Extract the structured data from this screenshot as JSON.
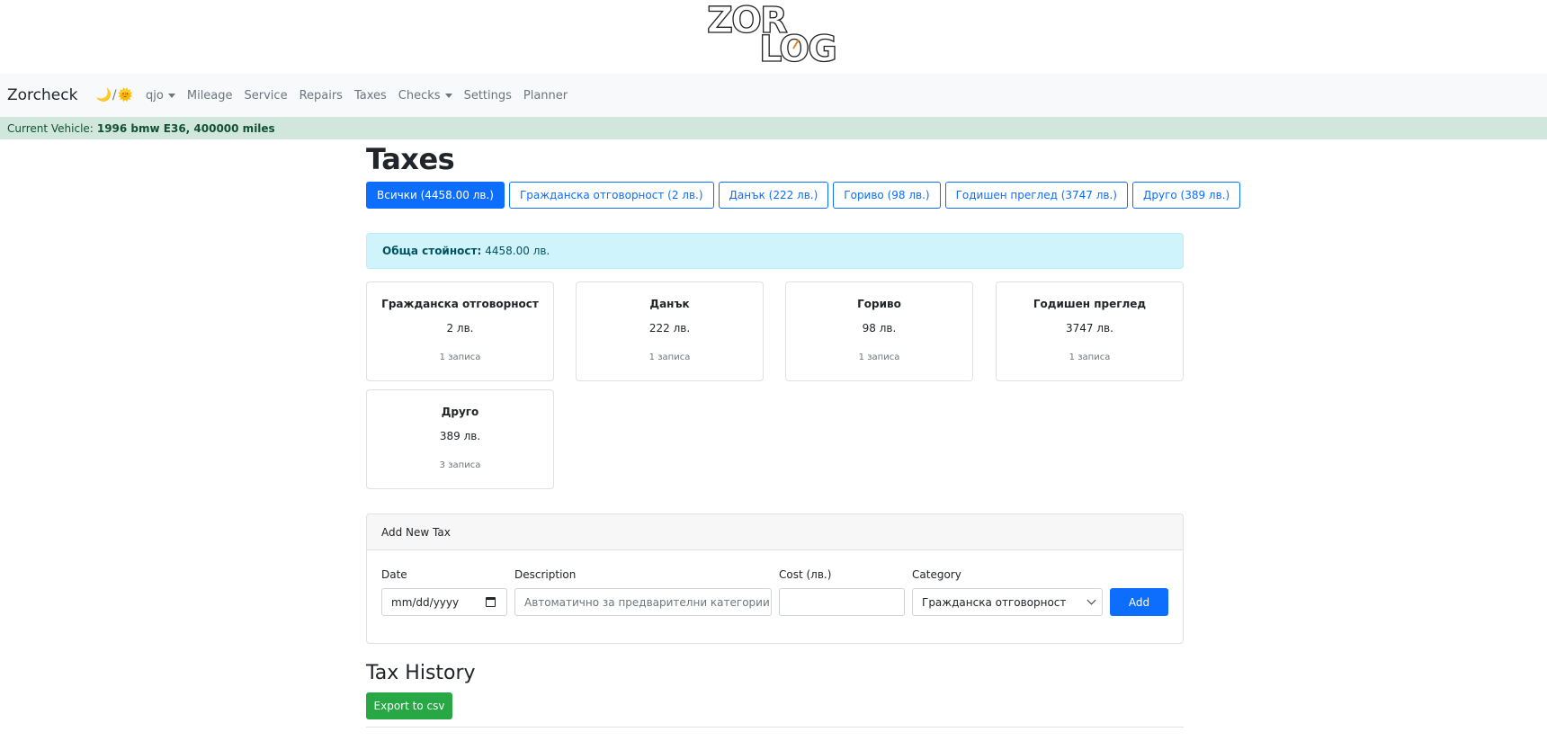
{
  "logo": {
    "line1": "ZOR",
    "line2": "LOG"
  },
  "navbar": {
    "brand": "Zorcheck",
    "theme_separator": "/",
    "items": [
      {
        "label": "qjo",
        "dropdown": true
      },
      {
        "label": "Mileage"
      },
      {
        "label": "Service"
      },
      {
        "label": "Repairs"
      },
      {
        "label": "Taxes"
      },
      {
        "label": "Checks",
        "dropdown": true
      },
      {
        "label": "Settings"
      },
      {
        "label": "Planner"
      }
    ]
  },
  "vehicle": {
    "prefix": "Current Vehicle:",
    "name": "1996 bmw E36, 400000 miles"
  },
  "page": {
    "title": "Taxes"
  },
  "filters": [
    {
      "label": "Всички (4458.00 лв.)",
      "active": true
    },
    {
      "label": "Гражданска отговорност (2 лв.)"
    },
    {
      "label": "Данък (222 лв.)"
    },
    {
      "label": "Гориво (98 лв.)"
    },
    {
      "label": "Годишен преглед (3747 лв.)"
    },
    {
      "label": "Друго (389 лв.)"
    }
  ],
  "total": {
    "label": "Обща стойност:",
    "value": "4458.00 лв."
  },
  "cards": [
    {
      "title": "Гражданска отговорност",
      "value": "2 лв.",
      "count": "1 записа"
    },
    {
      "title": "Данък",
      "value": "222 лв.",
      "count": "1 записа"
    },
    {
      "title": "Гориво",
      "value": "98 лв.",
      "count": "1 записа"
    },
    {
      "title": "Годишен преглед",
      "value": "3747 лв.",
      "count": "1 записа"
    },
    {
      "title": "Друго",
      "value": "389 лв.",
      "count": "3 записа"
    }
  ],
  "add_form": {
    "header": "Add New Tax",
    "date_label": "Date",
    "date_placeholder": "mm/dd/yyyy",
    "description_label": "Description",
    "description_placeholder": "Автоматично за предварителни категории",
    "cost_label": "Cost (лв.)",
    "cost_value": "",
    "category_label": "Category",
    "category_value": "Гражданска отговорност",
    "add_label": "Add"
  },
  "history": {
    "title": "Tax History",
    "export_label": "Export to csv"
  },
  "colors": {
    "primary": "#0d6efd",
    "success": "#28a745",
    "vehicle_bar": "#d1e7dd",
    "alert_info": "#cff4fc"
  }
}
